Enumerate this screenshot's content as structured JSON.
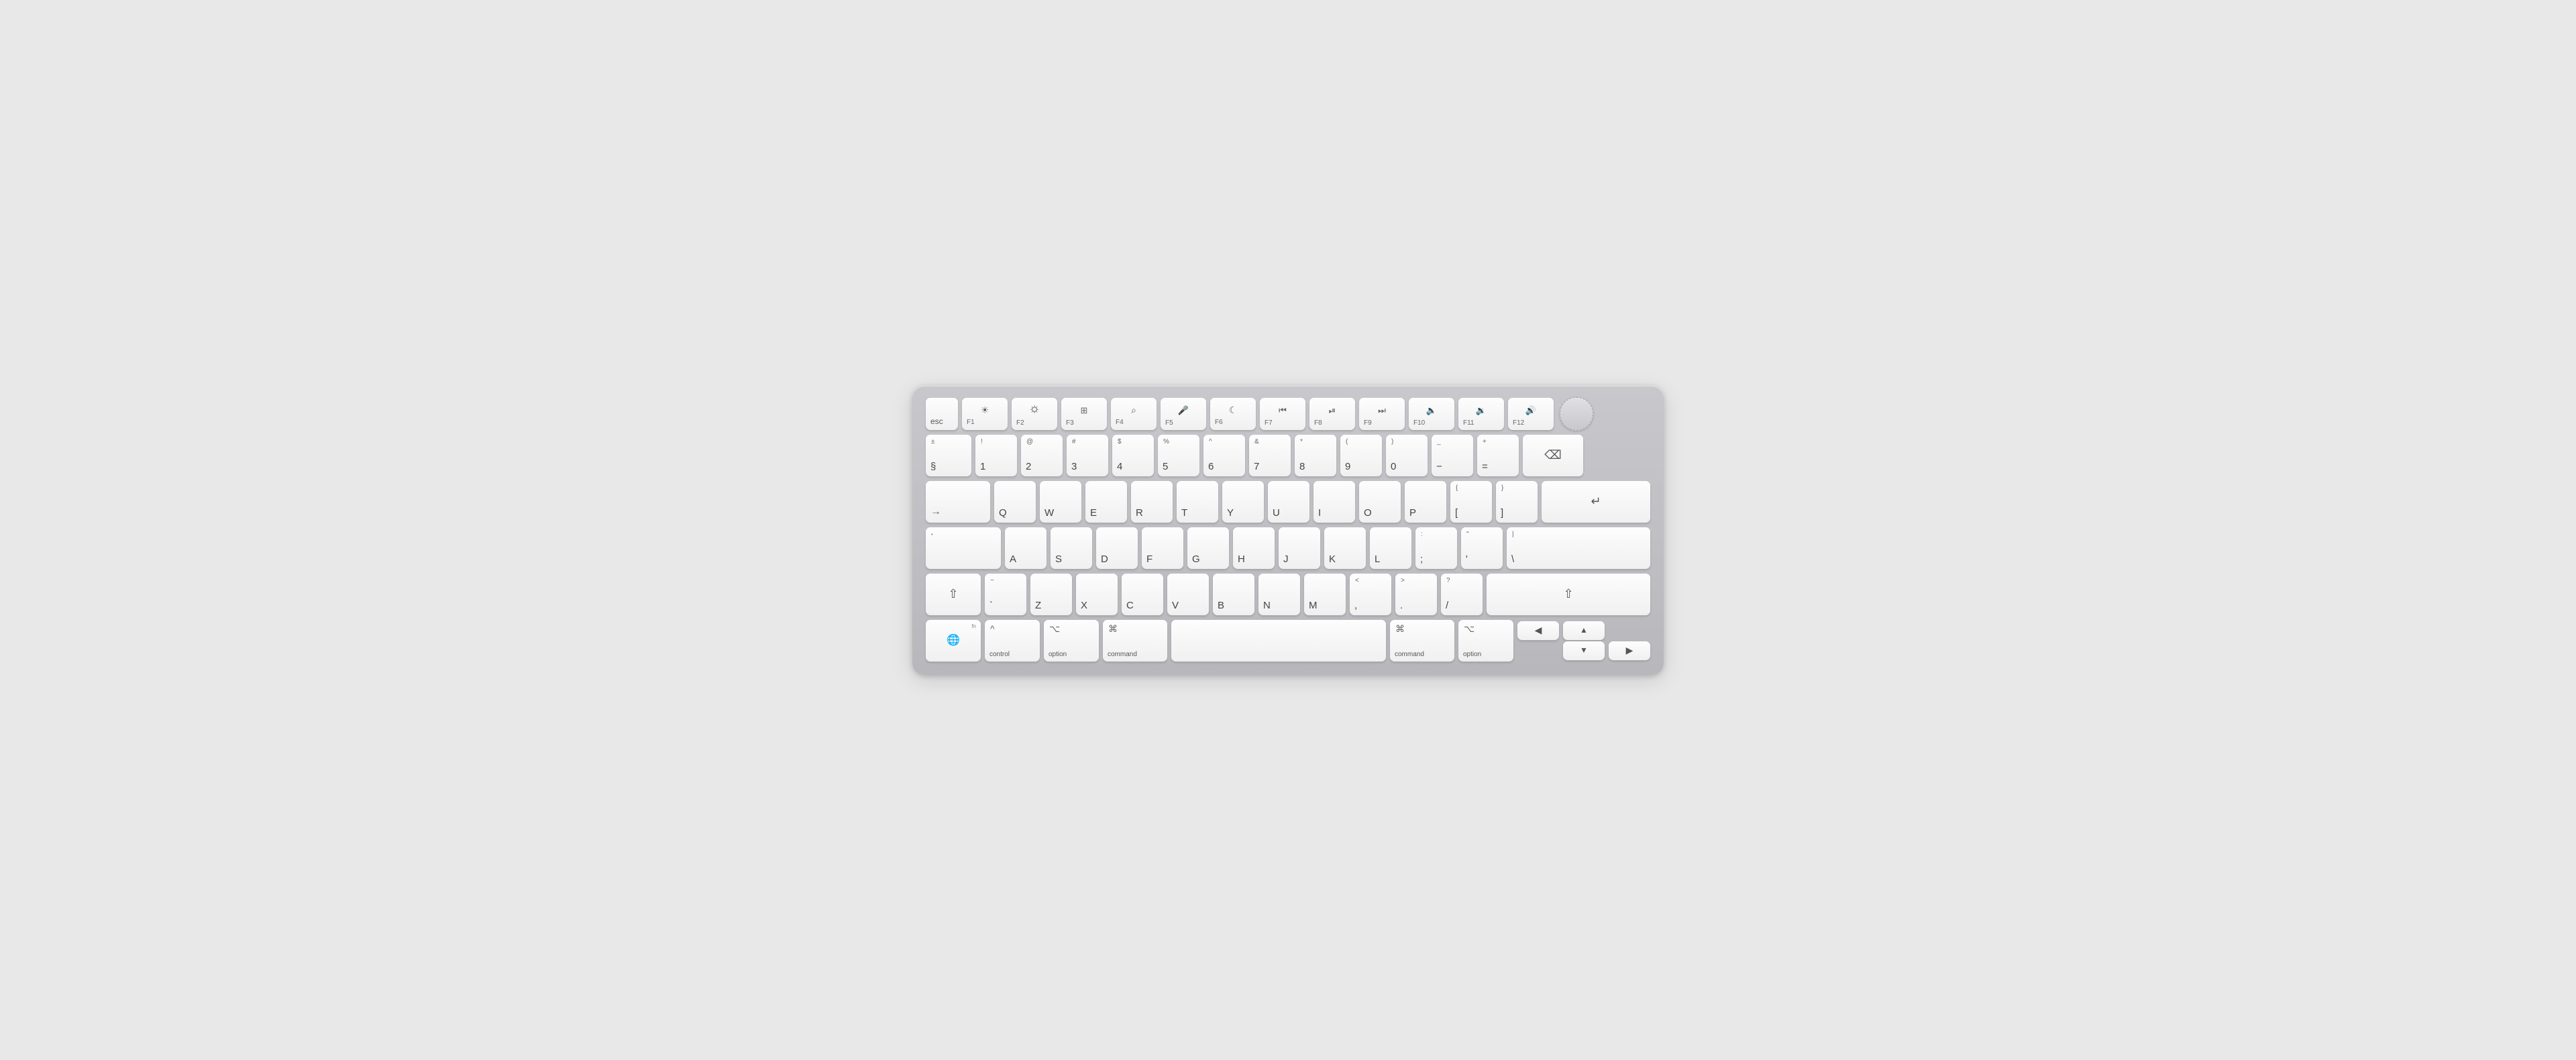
{
  "keyboard": {
    "rows": {
      "fn_row": {
        "keys": [
          {
            "id": "esc",
            "label": "esc",
            "width": "esc"
          },
          {
            "id": "f1",
            "icon": "☀",
            "sub": "F1",
            "width": "fn"
          },
          {
            "id": "f2",
            "icon": "☀",
            "sub": "F2",
            "width": "fn"
          },
          {
            "id": "f3",
            "icon": "⊞",
            "sub": "F3",
            "width": "fn"
          },
          {
            "id": "f4",
            "icon": "⌕",
            "sub": "F4",
            "width": "fn"
          },
          {
            "id": "f5",
            "icon": "🎤",
            "sub": "F5",
            "width": "fn"
          },
          {
            "id": "f6",
            "icon": "☾",
            "sub": "F6",
            "width": "fn"
          },
          {
            "id": "f7",
            "icon": "⏮",
            "sub": "F7",
            "width": "fn"
          },
          {
            "id": "f8",
            "icon": "⏯",
            "sub": "F8",
            "width": "fn"
          },
          {
            "id": "f9",
            "icon": "⏭",
            "sub": "F9",
            "width": "fn"
          },
          {
            "id": "f10",
            "icon": "🔈",
            "sub": "F10",
            "width": "fn"
          },
          {
            "id": "f11",
            "icon": "🔉",
            "sub": "F11",
            "width": "fn"
          },
          {
            "id": "f12",
            "icon": "🔊",
            "sub": "F12",
            "width": "fn"
          },
          {
            "id": "touchid",
            "label": "",
            "width": "touchid"
          }
        ]
      },
      "number_row": {
        "keys": [
          {
            "id": "backtick",
            "top": "±",
            "main": "§",
            "width": "std"
          },
          {
            "id": "1",
            "top": "!",
            "main": "1",
            "width": "std"
          },
          {
            "id": "2",
            "top": "@",
            "main": "2",
            "width": "std"
          },
          {
            "id": "3",
            "top": "#",
            "main": "3",
            "width": "std"
          },
          {
            "id": "4",
            "top": "$",
            "main": "4",
            "width": "std"
          },
          {
            "id": "5",
            "top": "%",
            "main": "5",
            "width": "std"
          },
          {
            "id": "6",
            "top": "^",
            "main": "6",
            "width": "std"
          },
          {
            "id": "7",
            "top": "&",
            "main": "7",
            "width": "std"
          },
          {
            "id": "8",
            "top": "*",
            "main": "8",
            "width": "std"
          },
          {
            "id": "9",
            "top": "(",
            "main": "9",
            "width": "std"
          },
          {
            "id": "0",
            "top": ")",
            "main": "0",
            "width": "std"
          },
          {
            "id": "minus",
            "top": "_",
            "main": "−",
            "width": "std"
          },
          {
            "id": "equals",
            "top": "+",
            "main": "=",
            "width": "std"
          },
          {
            "id": "backspace",
            "icon": "⌫",
            "width": "backspace"
          }
        ]
      },
      "qwerty_row": {
        "keys": [
          {
            "id": "tab",
            "icon": "→",
            "sub": "",
            "width": "tab"
          },
          {
            "id": "q",
            "main": "Q",
            "width": "std"
          },
          {
            "id": "w",
            "main": "W",
            "width": "std"
          },
          {
            "id": "e",
            "main": "E",
            "width": "std"
          },
          {
            "id": "r",
            "main": "R",
            "width": "std"
          },
          {
            "id": "t",
            "main": "T",
            "width": "std"
          },
          {
            "id": "y",
            "main": "Y",
            "width": "std"
          },
          {
            "id": "u",
            "main": "U",
            "width": "std"
          },
          {
            "id": "i",
            "main": "I",
            "width": "std"
          },
          {
            "id": "o",
            "main": "O",
            "width": "std"
          },
          {
            "id": "p",
            "main": "P",
            "width": "std"
          },
          {
            "id": "lbracket",
            "top": "{",
            "main": "[",
            "width": "std"
          },
          {
            "id": "rbracket",
            "top": "}",
            "main": "]",
            "width": "std"
          },
          {
            "id": "return",
            "icon": "↵",
            "width": "return"
          }
        ]
      },
      "asdf_row": {
        "keys": [
          {
            "id": "caps",
            "icon": "•",
            "width": "caps"
          },
          {
            "id": "a",
            "main": "A",
            "width": "std"
          },
          {
            "id": "s",
            "main": "S",
            "width": "std"
          },
          {
            "id": "d",
            "main": "D",
            "width": "std"
          },
          {
            "id": "f",
            "main": "F",
            "width": "std"
          },
          {
            "id": "g",
            "main": "G",
            "width": "std"
          },
          {
            "id": "h",
            "main": "H",
            "width": "std"
          },
          {
            "id": "j",
            "main": "J",
            "width": "std"
          },
          {
            "id": "k",
            "main": "K",
            "width": "std"
          },
          {
            "id": "l",
            "main": "L",
            "width": "std"
          },
          {
            "id": "semicolon",
            "top": ":",
            "main": ";",
            "width": "std"
          },
          {
            "id": "quote",
            "top": "\"",
            "main": "'",
            "width": "std"
          },
          {
            "id": "backslash",
            "top": "|",
            "main": "\\",
            "width": "std"
          }
        ]
      },
      "zxcv_row": {
        "keys": [
          {
            "id": "shift-l",
            "icon": "⇧",
            "width": "shift-l"
          },
          {
            "id": "backtick2",
            "top": "~",
            "main": "`",
            "width": "std"
          },
          {
            "id": "z",
            "main": "Z",
            "width": "std"
          },
          {
            "id": "x",
            "main": "X",
            "width": "std"
          },
          {
            "id": "c",
            "main": "C",
            "width": "std"
          },
          {
            "id": "v",
            "main": "V",
            "width": "std"
          },
          {
            "id": "b",
            "main": "B",
            "width": "std"
          },
          {
            "id": "n",
            "main": "N",
            "width": "std"
          },
          {
            "id": "m",
            "main": "M",
            "width": "std"
          },
          {
            "id": "comma",
            "top": "<",
            "main": ",",
            "width": "std"
          },
          {
            "id": "period",
            "top": ">",
            "main": ".",
            "width": "std"
          },
          {
            "id": "slash",
            "top": "?",
            "main": "/",
            "width": "std"
          },
          {
            "id": "shift-r",
            "icon": "⇧",
            "width": "shift-r"
          }
        ]
      },
      "bottom_row": {
        "keys": [
          {
            "id": "fn-globe",
            "top": "fn",
            "icon": "🌐",
            "width": "fn-globe"
          },
          {
            "id": "control",
            "top": "^",
            "sub": "control",
            "width": "control"
          },
          {
            "id": "option-l",
            "top": "⌥",
            "sub": "option",
            "width": "option"
          },
          {
            "id": "command-l",
            "top": "⌘",
            "sub": "command",
            "width": "command"
          },
          {
            "id": "space",
            "label": "",
            "width": "space"
          },
          {
            "id": "command-r",
            "top": "⌘",
            "sub": "command",
            "width": "command"
          },
          {
            "id": "option-r",
            "top": "⌥",
            "sub": "option",
            "width": "option"
          },
          {
            "id": "arrows",
            "width": "arrows"
          }
        ]
      }
    }
  }
}
